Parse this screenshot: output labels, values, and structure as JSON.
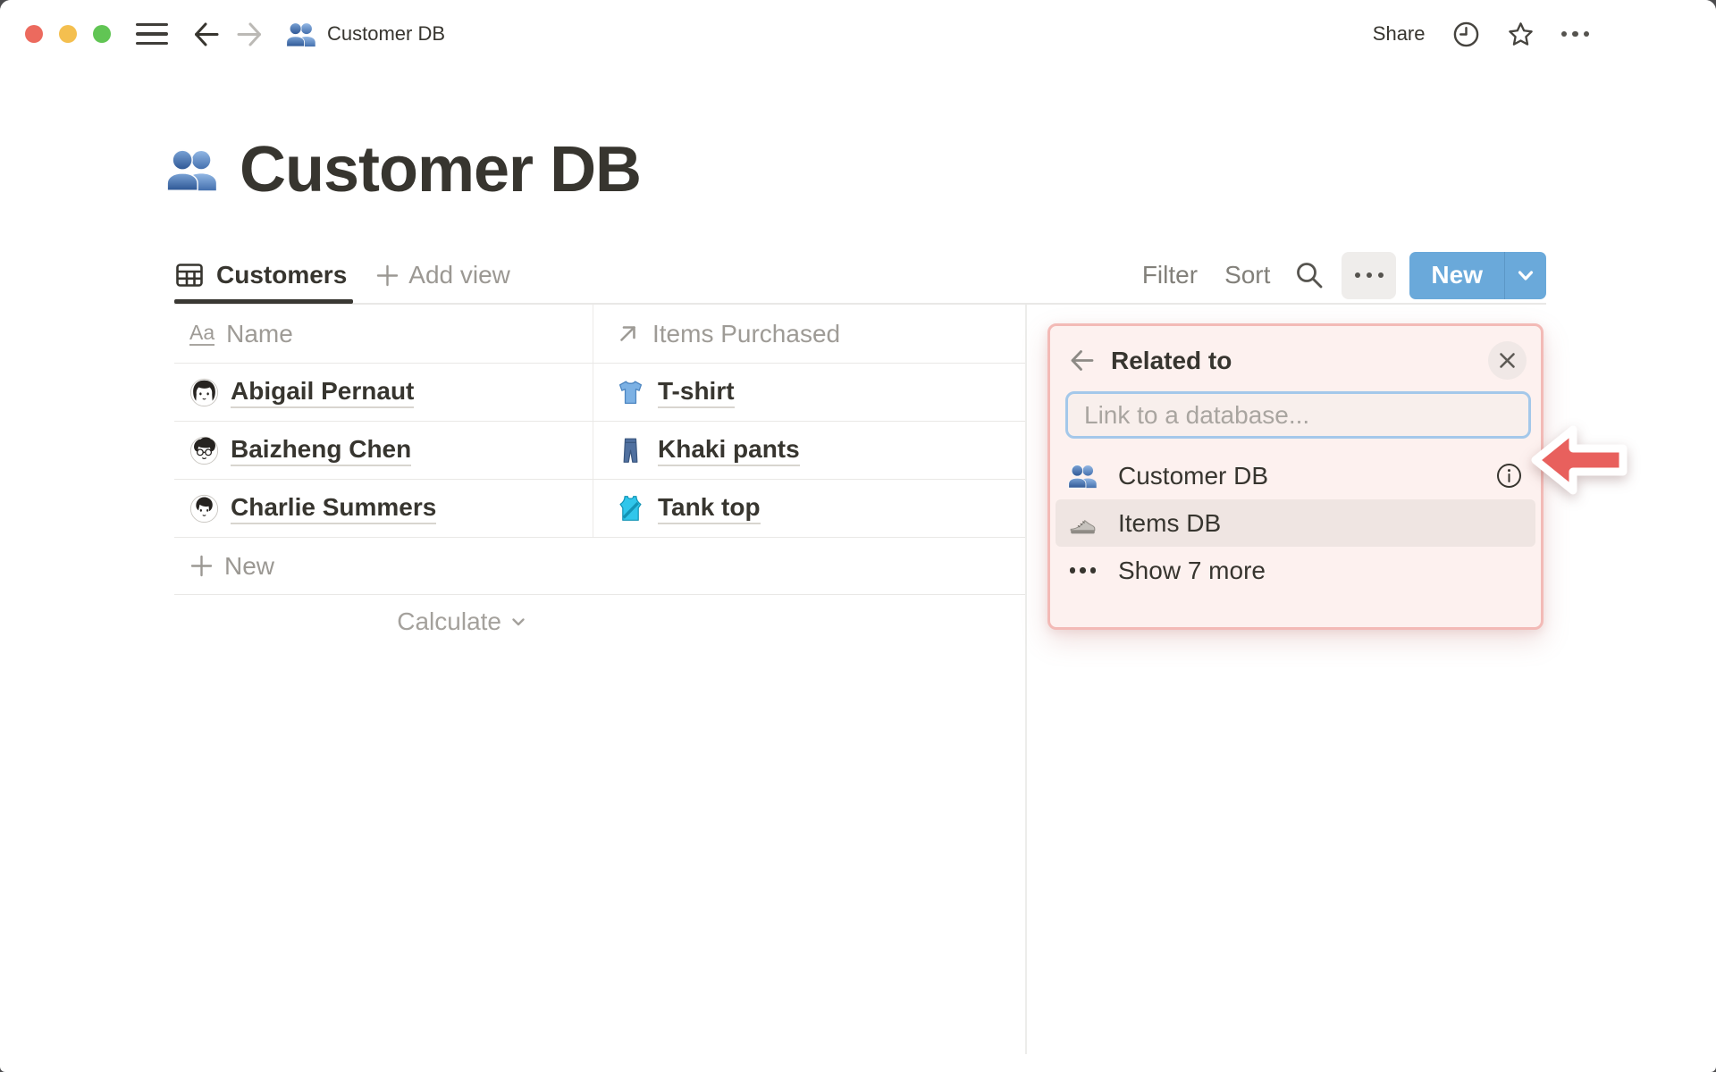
{
  "topbar": {
    "breadcrumb_title": "Customer DB",
    "share_label": "Share"
  },
  "page": {
    "title": "Customer DB"
  },
  "view_bar": {
    "active_tab": "Customers",
    "add_view": "Add view",
    "filter": "Filter",
    "sort": "Sort",
    "new_button": "New"
  },
  "table": {
    "columns": [
      {
        "label": "Name",
        "icon": "text-property-icon",
        "icon_text": "Aa"
      },
      {
        "label": "Items Purchased",
        "icon": "relation-arrow-icon"
      }
    ],
    "rows": [
      {
        "name": "Abigail Pernaut",
        "item": "T-shirt"
      },
      {
        "name": "Baizheng Chen",
        "item": "Khaki pants"
      },
      {
        "name": "Charlie Summers",
        "item": "Tank top"
      }
    ],
    "new_row": "New",
    "calculate": "Calculate"
  },
  "popup": {
    "title": "Related to",
    "input_placeholder": "Link to a database...",
    "options": [
      {
        "label": "Customer DB",
        "icon": "people-icon",
        "has_info": true
      },
      {
        "label": "Items DB",
        "icon": "sneaker-icon",
        "highlighted": true
      },
      {
        "label": "Show 7 more",
        "icon": "more-dots-icon"
      }
    ]
  },
  "colors": {
    "accent_blue": "#6aa9da",
    "annotation_red": "#e8605d",
    "popup_bg": "#fdf1ef",
    "popup_border": "#f3bab6",
    "input_focus_ring": "#a4c8ea",
    "row_highlight": "#efe5e2",
    "traffic_red": "#ec6a5e",
    "traffic_yellow": "#f4bf4f",
    "traffic_green": "#61c554"
  }
}
